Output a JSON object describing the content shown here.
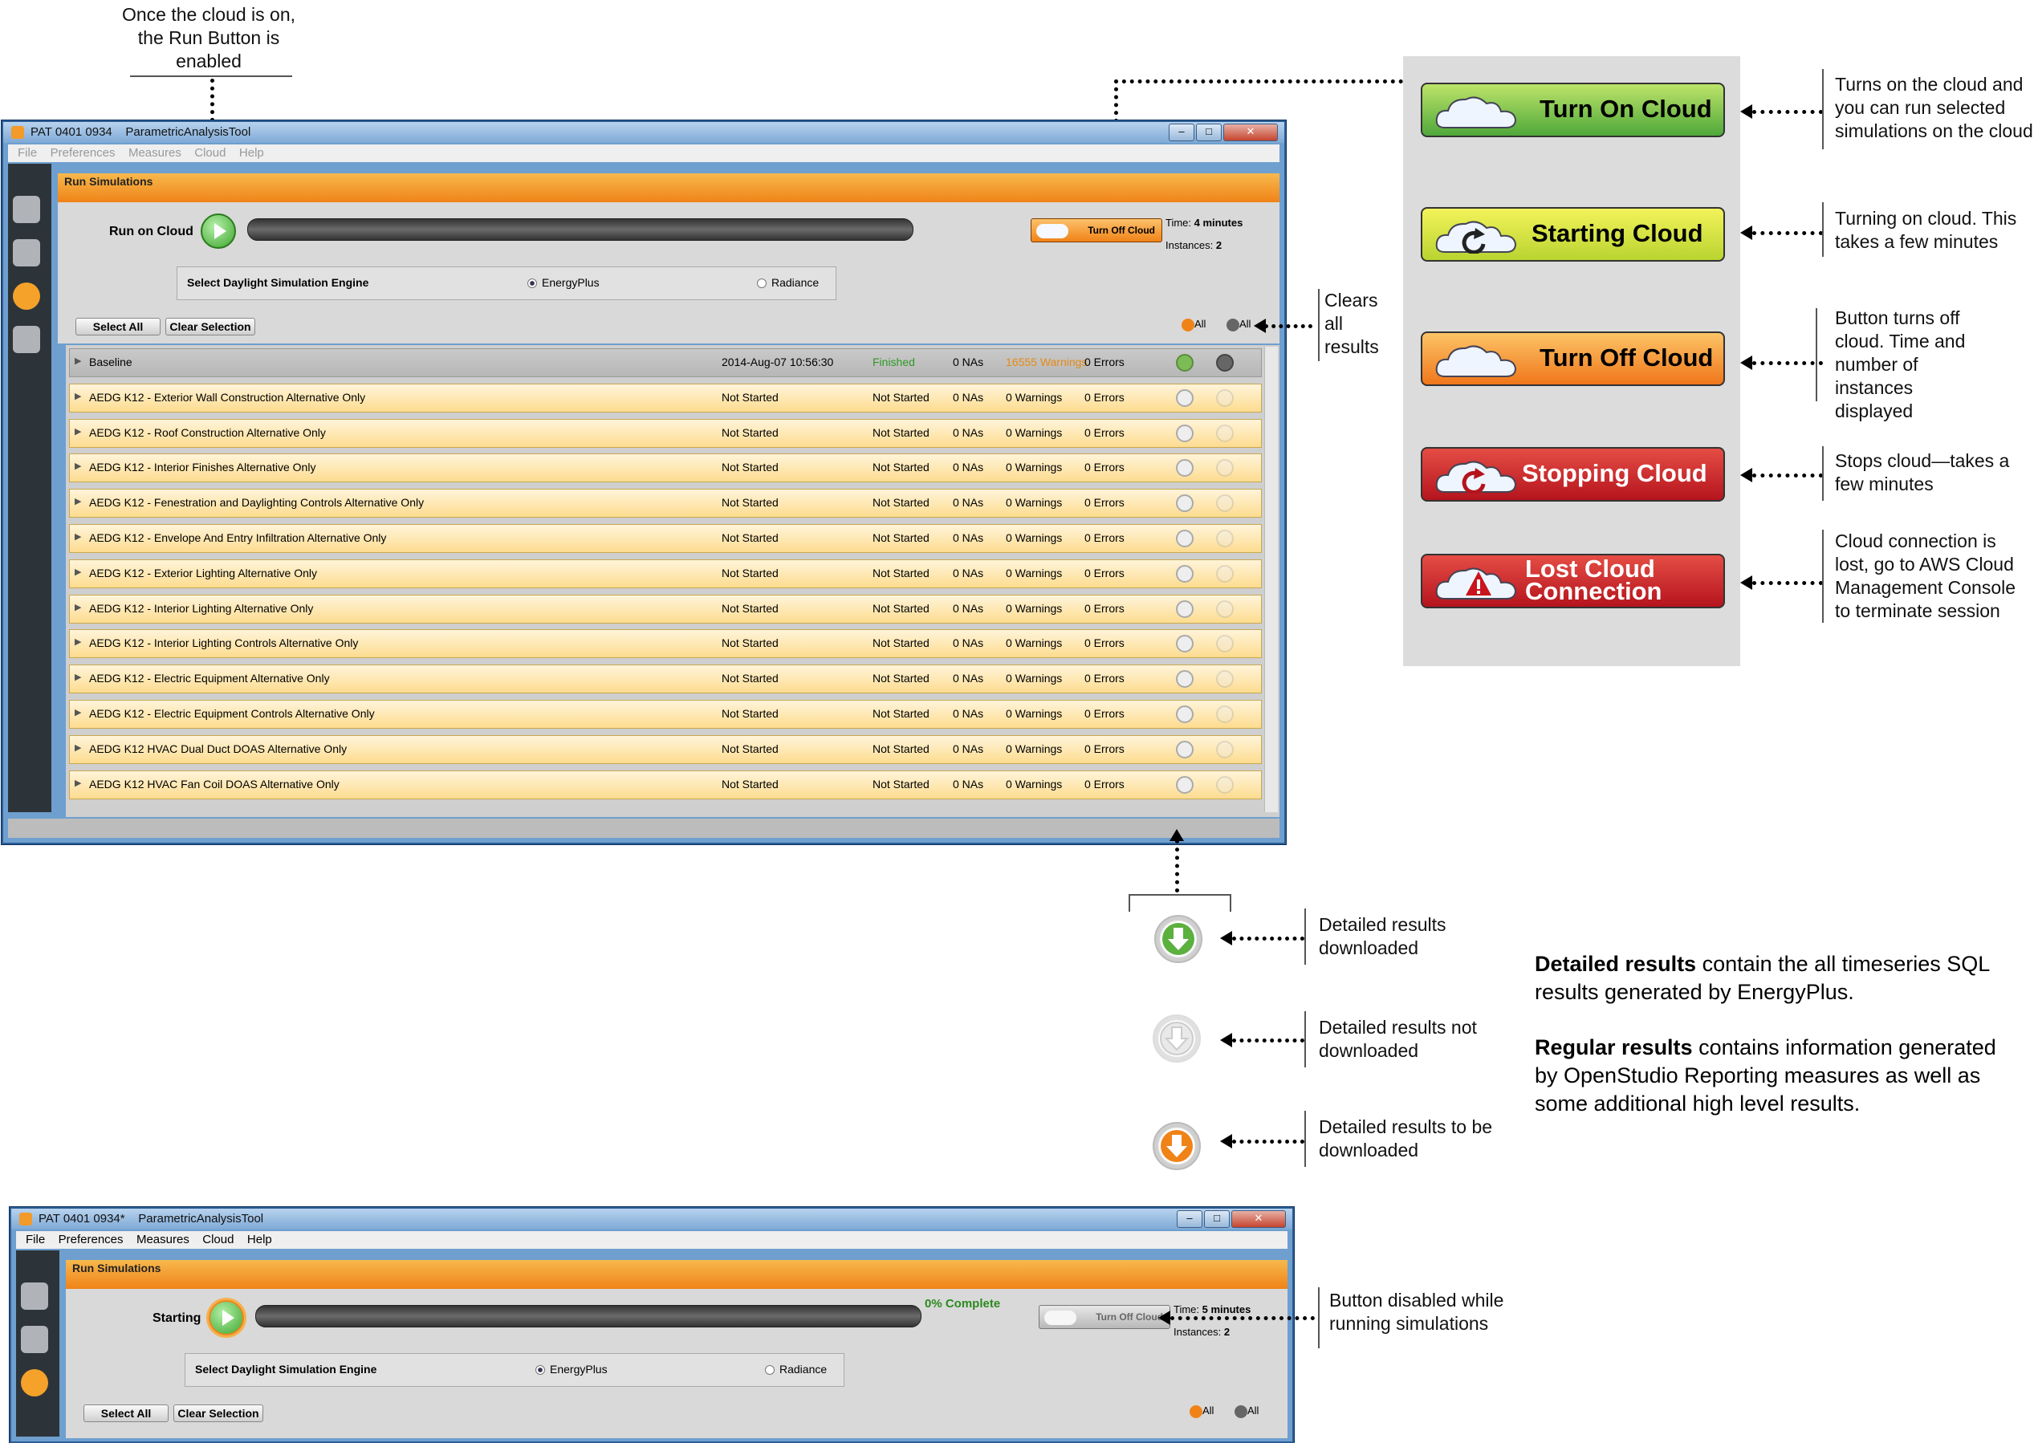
{
  "annotations": {
    "top_run": "Once the cloud is on, the Run Button is enabled",
    "turn_on": "Turns on the cloud and you can run selected simulations on the cloud",
    "starting": "Turning on cloud. This takes a few minutes",
    "turn_off": "Button turns off cloud. Time and number of instances displayed",
    "stopping": "Stops cloud—takes a few minutes",
    "lost": "Cloud connection is lost, go to AWS Cloud Management Console to terminate session",
    "clears": "Clears all results",
    "downloaded": "Detailed results downloaded",
    "not_downloaded": "Detailed results not downloaded",
    "to_download": "Detailed results to be downloaded",
    "disabled": "Button disabled while running simulations",
    "detailed_bold": "Detailed results",
    "detailed_rest": " contain the all timeseries SQL results generated by EnergyPlus.",
    "regular_bold": "Regular results",
    "regular_rest": " contains information generated by OpenStudio Reporting measures as well as some additional high level results."
  },
  "cloud_buttons": {
    "turn_on": "Turn On Cloud",
    "starting": "Starting Cloud",
    "turn_off": "Turn Off Cloud",
    "stopping": "Stopping Cloud",
    "lost_line1": "Lost Cloud",
    "lost_line2": "Connection"
  },
  "window1": {
    "title": "PAT 0401 0934    ParametricAnalysisTool",
    "menu": [
      "File",
      "Preferences",
      "Measures",
      "Cloud",
      "Help"
    ],
    "section": "Run Simulations",
    "run_label": "Run on Cloud",
    "turn_off_btn": "Turn Off Cloud",
    "time_label": "Time:",
    "time_value": "4 minutes",
    "instances_label": "Instances:",
    "instances_value": "2",
    "engine_label": "Select Daylight Simulation Engine",
    "engine_options": [
      "EnergyPlus",
      "Radiance"
    ],
    "select_all": "Select All",
    "clear_selection": "Clear Selection",
    "all_label": "All",
    "rows": [
      {
        "name": "Baseline",
        "date": "2014-Aug-07 10:56:30",
        "status": "Finished",
        "nas": "0 NAs",
        "warnings": "16555 Warnings",
        "errors": "0 Errors"
      },
      {
        "name": "AEDG K12 - Exterior Wall Construction Alternative Only",
        "date": "Not Started",
        "status": "Not Started",
        "nas": "0 NAs",
        "warnings": "0 Warnings",
        "errors": "0 Errors"
      },
      {
        "name": "AEDG K12 - Roof Construction Alternative Only",
        "date": "Not Started",
        "status": "Not Started",
        "nas": "0 NAs",
        "warnings": "0 Warnings",
        "errors": "0 Errors"
      },
      {
        "name": "AEDG K12 - Interior Finishes Alternative Only",
        "date": "Not Started",
        "status": "Not Started",
        "nas": "0 NAs",
        "warnings": "0 Warnings",
        "errors": "0 Errors"
      },
      {
        "name": "AEDG K12 - Fenestration and Daylighting Controls Alternative Only",
        "date": "Not Started",
        "status": "Not Started",
        "nas": "0 NAs",
        "warnings": "0 Warnings",
        "errors": "0 Errors"
      },
      {
        "name": "AEDG K12 - Envelope And Entry Infiltration Alternative Only",
        "date": "Not Started",
        "status": "Not Started",
        "nas": "0 NAs",
        "warnings": "0 Warnings",
        "errors": "0 Errors"
      },
      {
        "name": "AEDG K12 - Exterior Lighting Alternative Only",
        "date": "Not Started",
        "status": "Not Started",
        "nas": "0 NAs",
        "warnings": "0 Warnings",
        "errors": "0 Errors"
      },
      {
        "name": "AEDG K12 - Interior Lighting Alternative Only",
        "date": "Not Started",
        "status": "Not Started",
        "nas": "0 NAs",
        "warnings": "0 Warnings",
        "errors": "0 Errors"
      },
      {
        "name": "AEDG K12 - Interior Lighting Controls Alternative Only",
        "date": "Not Started",
        "status": "Not Started",
        "nas": "0 NAs",
        "warnings": "0 Warnings",
        "errors": "0 Errors"
      },
      {
        "name": "AEDG K12 - Electric Equipment Alternative Only",
        "date": "Not Started",
        "status": "Not Started",
        "nas": "0 NAs",
        "warnings": "0 Warnings",
        "errors": "0 Errors"
      },
      {
        "name": "AEDG K12 - Electric Equipment Controls Alternative Only",
        "date": "Not Started",
        "status": "Not Started",
        "nas": "0 NAs",
        "warnings": "0 Warnings",
        "errors": "0 Errors"
      },
      {
        "name": "AEDG K12 HVAC Dual Duct DOAS Alternative Only",
        "date": "Not Started",
        "status": "Not Started",
        "nas": "0 NAs",
        "warnings": "0 Warnings",
        "errors": "0 Errors"
      },
      {
        "name": "AEDG K12 HVAC Fan Coil DOAS Alternative Only",
        "date": "Not Started",
        "status": "Not Started",
        "nas": "0 NAs",
        "warnings": "0 Warnings",
        "errors": "0 Errors"
      }
    ]
  },
  "window2": {
    "title": "PAT 0401 0934*    ParametricAnalysisTool",
    "menu": [
      "File",
      "Preferences",
      "Measures",
      "Cloud",
      "Help"
    ],
    "section": "Run Simulations",
    "run_label": "Starting",
    "progress_text": "0% Complete",
    "turn_off_btn": "Turn Off Cloud",
    "time_label": "Time:",
    "time_value": "5 minutes",
    "instances_label": "Instances:",
    "instances_value": "2",
    "engine_label": "Select Daylight Simulation Engine",
    "engine_options": [
      "EnergyPlus",
      "Radiance"
    ],
    "select_all": "Select All",
    "clear_selection": "Clear Selection",
    "all_label": "All"
  },
  "colors": {
    "green_btn": "#4fa83a",
    "yellow_btn": "#c6d932",
    "orange_btn": "#f28a1d",
    "red_btn": "#c9252b",
    "accent_orange": "#f08318"
  }
}
